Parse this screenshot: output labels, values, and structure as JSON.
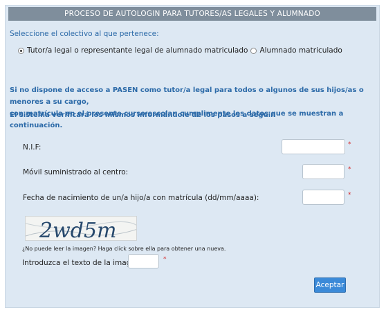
{
  "header": {
    "title": "PROCESO DE AUTOLOGIN PARA TUTORES/AS LEGALES Y ALUMNADO"
  },
  "question": {
    "label": "Seleccione el colectivo al que pertenece:"
  },
  "radio_options": [
    {
      "label": "Tutor/a legal o representante legal de alumnado matriculado",
      "checked": true
    },
    {
      "label": "Alumnado matriculado",
      "checked": false
    }
  ],
  "info": {
    "line1": "Si no dispone de acceso a PASEN como tutor/a legal para todos o algunos de sus hijos/as o menores a su cargo,",
    "line2": "con matrícula en el presente curso escolar, cumplimente los datos que se muestran a continuación.",
    "line3": "El sistema verificará los mismos informándole de los pasos a seguir."
  },
  "form": {
    "nif_label": "N.I.F:",
    "nif_value": "",
    "movil_label": "Móvil suministrado al centro:",
    "movil_value": "",
    "fecha_label": "Fecha de nacimiento de un/a hijo/a con matrícula (dd/mm/aaaa):",
    "fecha_value": "",
    "required_mark": "*"
  },
  "captcha": {
    "image_text": "2wd5m",
    "hint": "¿No puede leer la imagen? Haga click sobre ella para obtener una nueva.",
    "input_label": "Introduzca el texto de la imagen:",
    "input_value": ""
  },
  "actions": {
    "submit_label": "Aceptar"
  },
  "colors": {
    "panel_bg": "#dde8f3",
    "title_bg": "#7f8e9c",
    "info_blue": "#2c6aa8",
    "button_blue": "#3b8ad8",
    "required_red": "#d62d2d"
  }
}
